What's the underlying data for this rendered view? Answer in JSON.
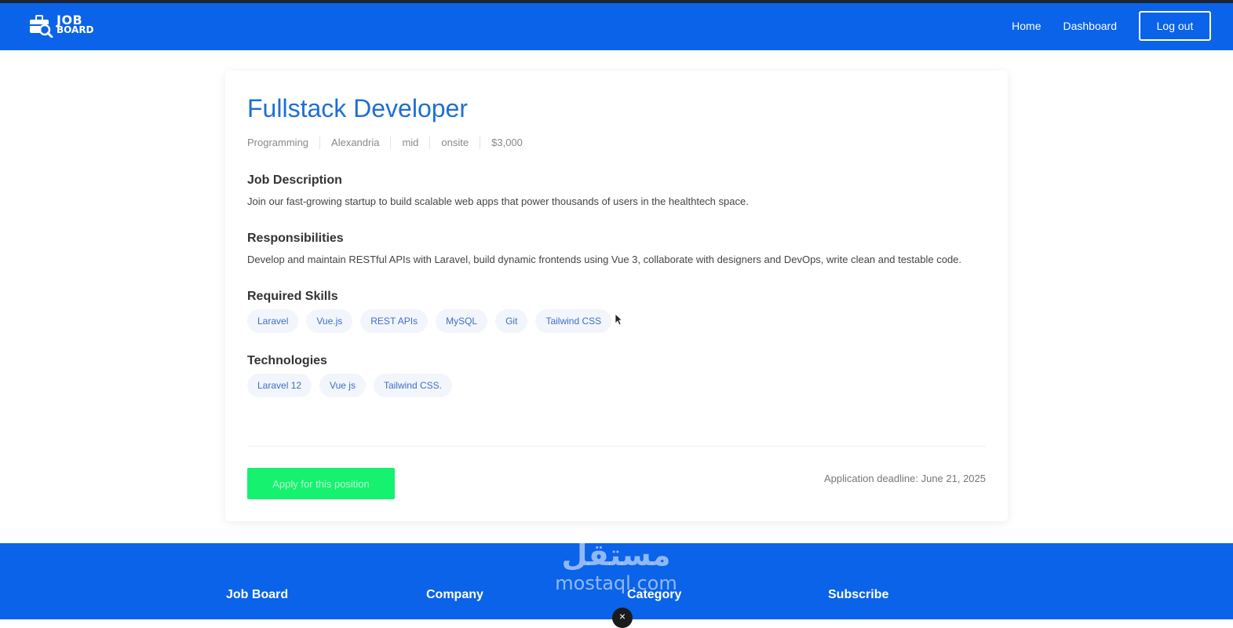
{
  "header": {
    "logo_line1": "JOB",
    "logo_line2": "BOARD",
    "nav": [
      "Home",
      "Dashboard"
    ],
    "logout_label": "Log out",
    "accent": "#0a63e8"
  },
  "job": {
    "title": "Fullstack Developer",
    "meta": [
      "Programming",
      "Alexandria",
      "mid",
      "onsite",
      "$3,000"
    ],
    "description_title": "Job Description",
    "description": "Join our fast-growing startup to build scalable web apps that power thousands of users in the healthtech space.",
    "responsibilities_title": "Responsibilities",
    "responsibilities": "Develop and maintain RESTful APIs with Laravel, build dynamic frontends using Vue 3, collaborate with designers and DevOps, write clean and testable code.",
    "skills_title": "Required Skills",
    "skills": [
      "Laravel",
      "Vue.js",
      "REST APIs",
      "MySQL",
      "Git",
      "Tailwind CSS"
    ],
    "technologies_title": "Technologies",
    "technologies": [
      "Laravel 12",
      "Vue js",
      "Tailwind CSS."
    ],
    "apply_label": "Apply for this position",
    "deadline": "Application deadline: June 21, 2025",
    "apply_color": "#16f26f"
  },
  "footer": {
    "columns": [
      "Job Board",
      "Company",
      "Category",
      "Subscribe"
    ]
  },
  "watermark": {
    "arabic": "مستقل",
    "latin": "mostaql.com"
  },
  "overlay": {
    "close_glyph": "×"
  }
}
